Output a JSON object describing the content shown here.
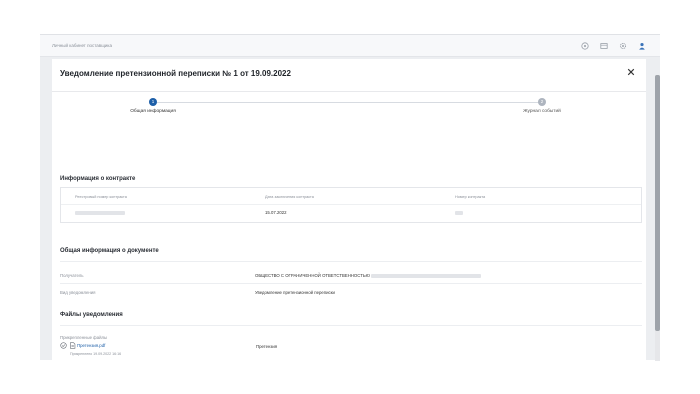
{
  "app": {
    "portal_title": "Личный кабинет поставщика",
    "top_icons": [
      "help-icon",
      "document-icon",
      "settings-icon",
      "user-icon"
    ]
  },
  "modal": {
    "title": "Уведомление претензионной переписки № 1 от 19.09.2022",
    "close_icon": "close-icon"
  },
  "stepper": {
    "steps": [
      {
        "number": "1",
        "label": "Общая информация",
        "state": "active"
      },
      {
        "number": "2",
        "label": "Журнал событий",
        "state": "inactive"
      }
    ]
  },
  "contract": {
    "section_title": "Информация о контракте",
    "headers": [
      "Реестровый номер контракта",
      "Дата заключения контракта",
      "Номер контракта"
    ],
    "values": {
      "registry_number": "",
      "date": "15.07.2022",
      "number": ""
    }
  },
  "document": {
    "section_title": "Общая информация о документе",
    "recipient_label": "Получатель",
    "recipient_value": "ОБЩЕСТВО С ОГРАНИЧЕННОЙ ОТВЕТСТВЕННОСТЬЮ",
    "type_label": "Вид уведомления",
    "type_value": "Уведомление претензионной переписки"
  },
  "files": {
    "section_title": "Файлы уведомления",
    "attached_label": "Прикрепленные файлы",
    "items": [
      {
        "name": "Претензия.pdf",
        "meta": "Прикреплено 19.09.2022 16:16",
        "type": "Претензия"
      }
    ]
  },
  "colors": {
    "accent": "#1d5fa8",
    "inactive_step": "#aeb5bf",
    "background": "#eceef1"
  }
}
